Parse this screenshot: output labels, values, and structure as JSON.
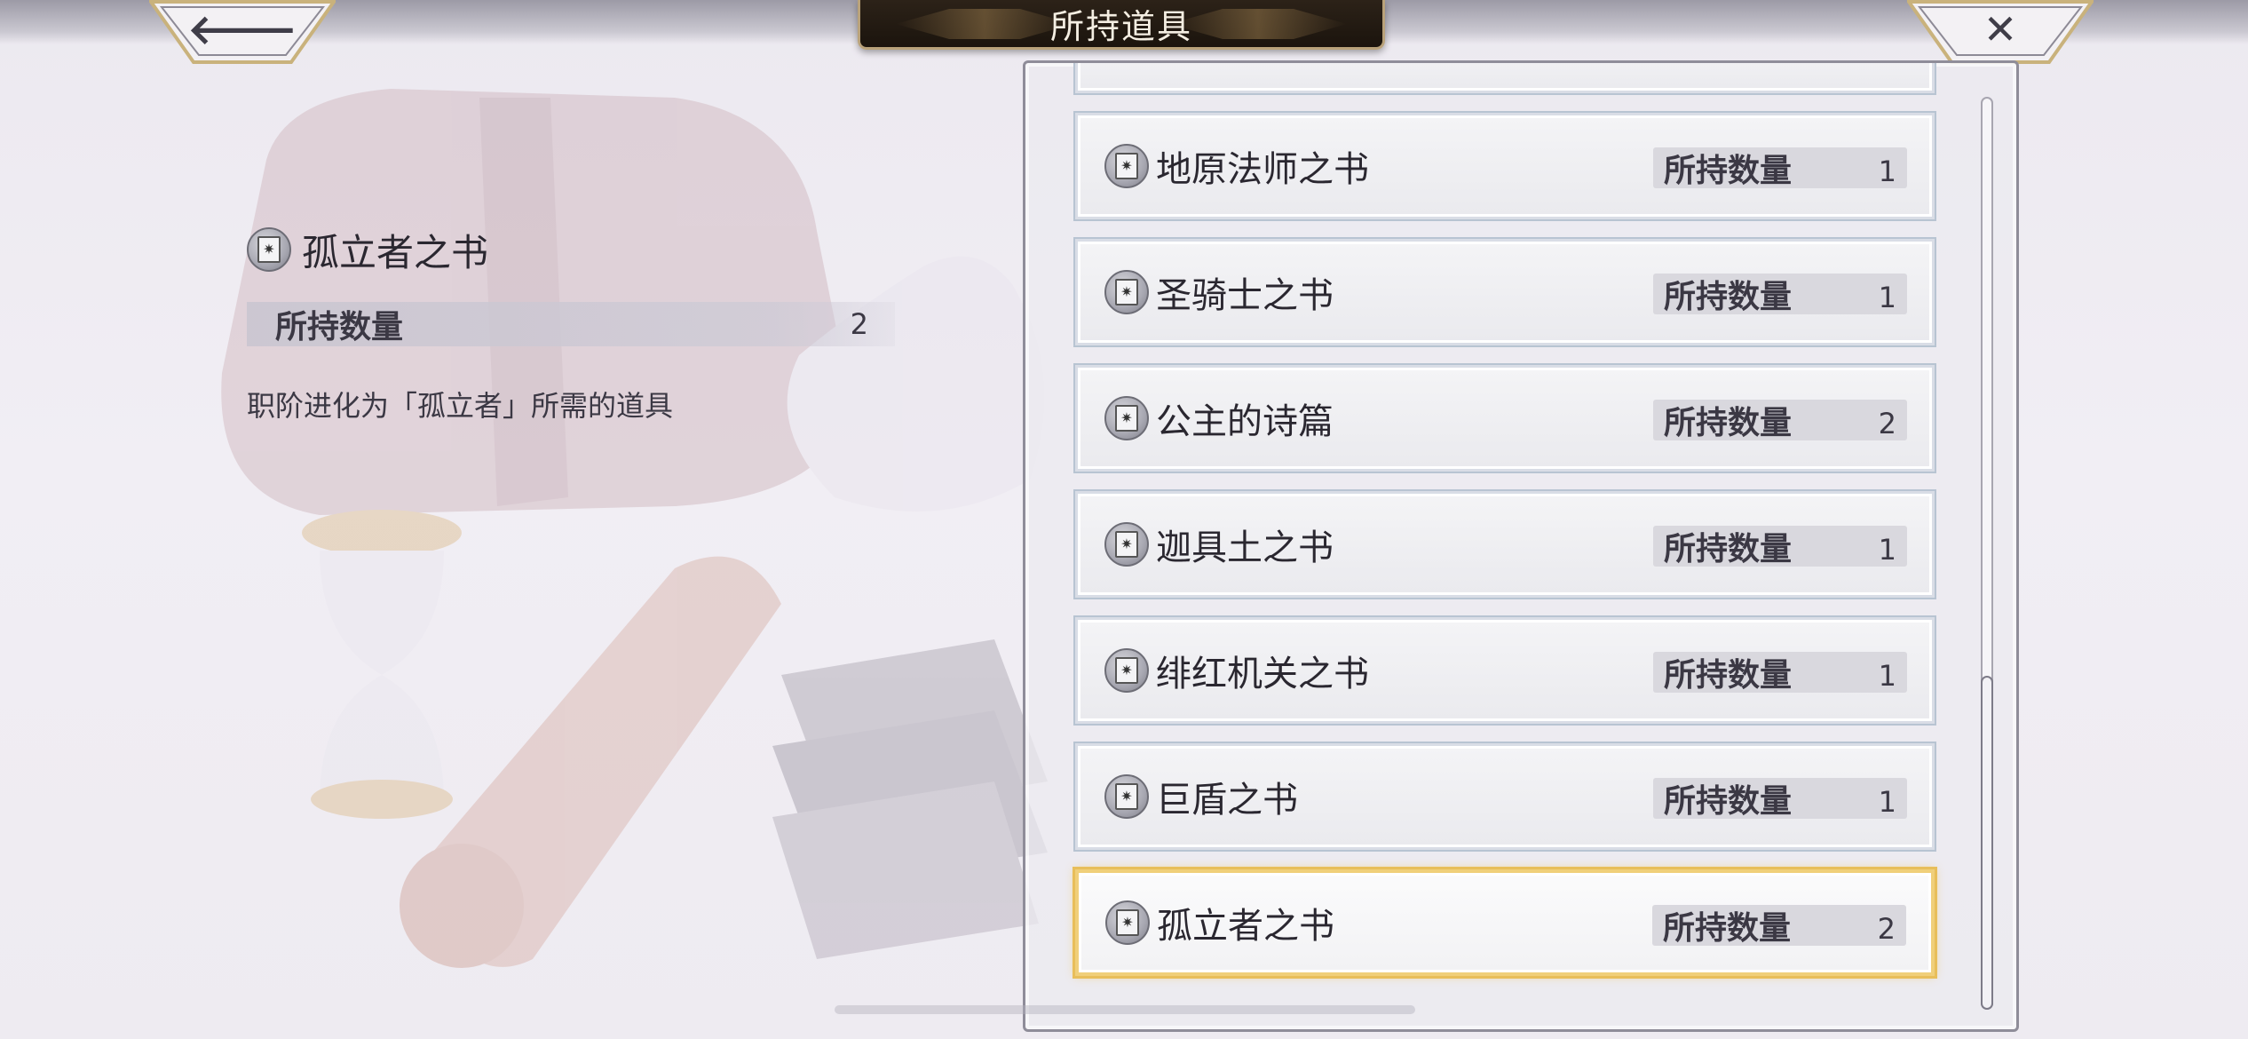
{
  "header": {
    "title": "所持道具",
    "back_glyph": "🡐",
    "close_glyph": "✕"
  },
  "detail": {
    "item_name": "孤立者之书",
    "qty_label": "所持数量",
    "qty_value": "2",
    "description": "职阶进化为「孤立者」所需的道具",
    "icon": "book-icon"
  },
  "list": {
    "items": [
      {
        "name": "地原法师之书",
        "qty_label": "所持数量",
        "qty": "1"
      },
      {
        "name": "圣骑士之书",
        "qty_label": "所持数量",
        "qty": "1"
      },
      {
        "name": "公主的诗篇",
        "qty_label": "所持数量",
        "qty": "2"
      },
      {
        "name": "迦具土之书",
        "qty_label": "所持数量",
        "qty": "1"
      },
      {
        "name": "绯红机关之书",
        "qty_label": "所持数量",
        "qty": "1"
      },
      {
        "name": "巨盾之书",
        "qty_label": "所持数量",
        "qty": "1"
      },
      {
        "name": "孤立者之书",
        "qty_label": "所持数量",
        "qty": "2"
      }
    ],
    "selected_index": 6
  },
  "colors": {
    "selected_border": "#f0cf7a",
    "title_plate": "#1b140d",
    "title_trim": "#b9a27a"
  }
}
